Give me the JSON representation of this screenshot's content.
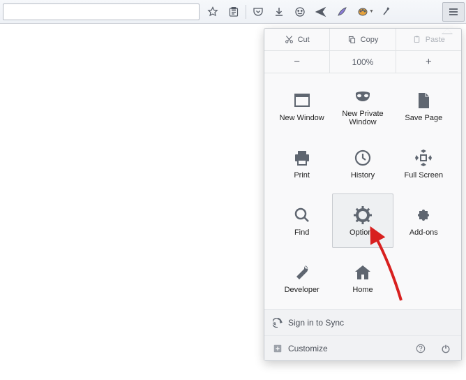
{
  "edit": {
    "cut": "Cut",
    "copy": "Copy",
    "paste": "Paste"
  },
  "zoom": {
    "minus": "−",
    "value": "100%",
    "plus": "+"
  },
  "items": {
    "newwin": "New Window",
    "private": "New Private Window",
    "save": "Save Page",
    "print": "Print",
    "history": "History",
    "fullscreen": "Full Screen",
    "find": "Find",
    "options": "Options",
    "addons": "Add-ons",
    "developer": "Developer",
    "home": "Home"
  },
  "footer": {
    "sync": "Sign in to Sync",
    "customize": "Customize"
  }
}
